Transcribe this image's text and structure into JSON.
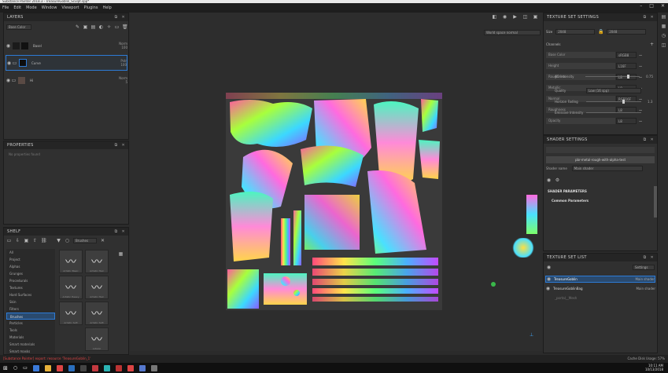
{
  "window": {
    "title": "Substance Painter 2018.3 - TreasureGoblin_Sculpt.spp*"
  },
  "menu": [
    "File",
    "Edit",
    "Mode",
    "Window",
    "Viewport",
    "Plugins",
    "Help"
  ],
  "layers": {
    "title": "LAYERS",
    "channel_select": "Base Color",
    "items": [
      {
        "name": "Basel",
        "blend": "Norm",
        "opacity": "100"
      },
      {
        "name": "Curve",
        "blend": "Pstr",
        "opacity": "100"
      },
      {
        "name": "Hi",
        "blend": "Norm",
        "opacity": "5"
      }
    ]
  },
  "properties": {
    "title": "PROPERTIES",
    "empty_text": "No properties found"
  },
  "shelf": {
    "title": "SHELF",
    "search_value": "Brushes",
    "categories": [
      "All",
      "Project",
      "Alphas",
      "Grunges",
      "Procedurals",
      "Textures",
      "Hard Surfaces",
      "Skin",
      "Filters",
      "Brushes",
      "Particles",
      "Tools",
      "Materials",
      "Smart materials",
      "Smart masks"
    ],
    "selected_category": "Brushes",
    "brushes": [
      "Artistic Basic",
      "Artistic Hair",
      "Artistic Heavy",
      "Artistic Hair",
      "Artistic Soft",
      "Artistic Soft",
      "",
      "Artistic"
    ]
  },
  "viewport": {
    "display_mode": "World space normal"
  },
  "texture_set_settings": {
    "title": "TEXTURE SET SETTINGS",
    "size_label": "Size",
    "size_value": "2048",
    "size_value_2": "2048",
    "channels_label": "Channels",
    "channels": [
      {
        "name": "Base Color",
        "format": "sRGB8"
      },
      {
        "name": "Height",
        "format": "L16F"
      },
      {
        "name": "Roughness",
        "format": "L8"
      },
      {
        "name": "Metallic",
        "format": "L8"
      },
      {
        "name": "Normal",
        "format": "RGB16F"
      },
      {
        "name": "Roughness",
        "format": "L8"
      },
      {
        "name": "Opacity",
        "format": "L8"
      }
    ]
  },
  "shader_settings": {
    "title": "SHADER SETTINGS",
    "shader_name": "pbr-metal-rough-with-alpha-test",
    "shader_label": "Shader name",
    "shader_value": "Main shader",
    "section": "SHADER PARAMETERS",
    "group": "Common Parameters",
    "params": [
      {
        "label": "AO Intensity",
        "value": "0.75",
        "fill": 0.75
      },
      {
        "label": "Quality",
        "value": "Low (16 spp)",
        "fill": 0
      },
      {
        "label": "Horizon Fading",
        "value": "1.3",
        "fill": 0.65
      },
      {
        "label": "Emissive Intensity",
        "value": "",
        "fill": 0
      }
    ]
  },
  "texture_set_list": {
    "title": "TEXTURE SET LIST",
    "settings_label": "Settings",
    "items": [
      {
        "name": "TreasureGoblin",
        "shader": "Main shader"
      },
      {
        "name": "TreasureGoblinBag",
        "shader": "Main shader"
      },
      {
        "name": "_portal__Mesh",
        "shader": ""
      }
    ]
  },
  "status": {
    "message": "[Substance Painter] export: resource 'TreasureGoblin_1'",
    "right": "Cache Disk Usage: 57%"
  },
  "taskbar": {
    "time": "10:11 AM",
    "date": "10/13/2018"
  },
  "colors": {
    "accent": "#2d7bd6",
    "panel": "#303030",
    "header": "#252525"
  }
}
